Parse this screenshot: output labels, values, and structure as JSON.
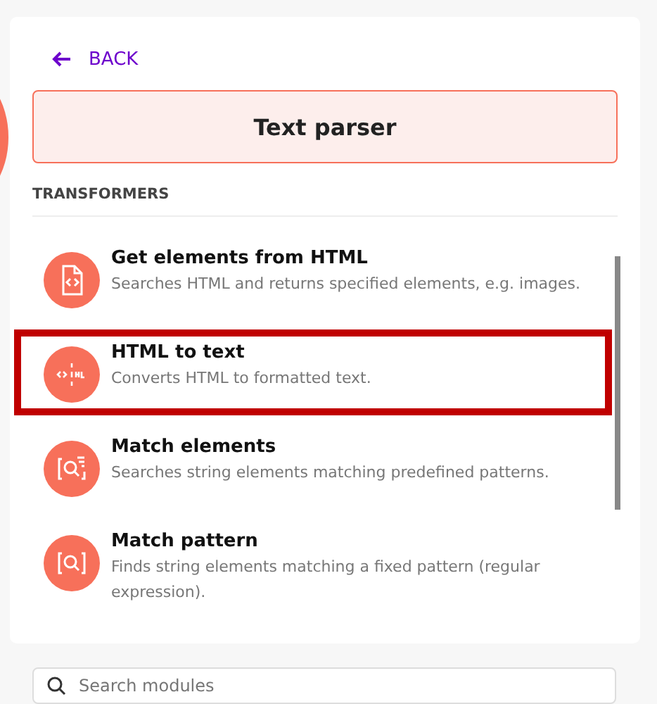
{
  "back": {
    "label": "BACK"
  },
  "app_title": "Text parser",
  "section": "TRANSFORMERS",
  "modules": [
    {
      "kind": "file",
      "title": "Get elements from HTML",
      "description": "Searches HTML and returns specified elements, e.g. images.",
      "highlighted": false
    },
    {
      "kind": "split",
      "title": "HTML to text",
      "description": "Converts HTML to formatted text.",
      "highlighted": true
    },
    {
      "kind": "scan-lines",
      "title": "Match elements",
      "description": "Searches string elements matching predefined patterns.",
      "highlighted": false
    },
    {
      "kind": "scan",
      "title": "Match pattern",
      "description": "Finds string elements matching a fixed pattern (regular expression).",
      "highlighted": false
    }
  ],
  "search": {
    "placeholder": "Search modules"
  }
}
